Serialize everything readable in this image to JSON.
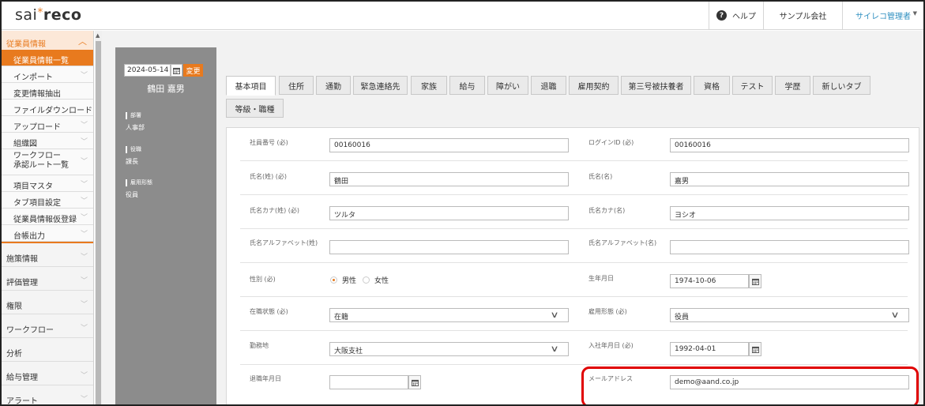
{
  "header": {
    "logo_part1": "sai",
    "logo_star": "*",
    "logo_part2": "reco",
    "help_label": "ヘルプ",
    "company": "サンプル会社",
    "admin_user": "サイレコ管理者"
  },
  "sidebar": {
    "section_title": "従業員情報",
    "items": [
      {
        "label": "従業員情報一覧"
      },
      {
        "label": "インポート"
      },
      {
        "label": "変更情報抽出"
      },
      {
        "label": "ファイルダウンロード"
      },
      {
        "label": "アップロード"
      },
      {
        "label": "組織図"
      },
      {
        "label": "ワークフロー",
        "label2": "承認ルート一覧"
      },
      {
        "label": "項目マスタ"
      },
      {
        "label": "タブ項目設定"
      },
      {
        "label": "従業員情報仮登録"
      },
      {
        "label": "台帳出力"
      }
    ],
    "main_items": [
      {
        "label": "施策情報"
      },
      {
        "label": "評価管理"
      },
      {
        "label": "権限"
      },
      {
        "label": "ワークフロー"
      },
      {
        "label": "分析"
      },
      {
        "label": "給与管理"
      },
      {
        "label": "アラート"
      }
    ]
  },
  "profile": {
    "date": "2024-05-14",
    "change_button": "変更",
    "name": "鶴田 嘉男",
    "department_label": "部署",
    "department": "人事部",
    "position_label": "役職",
    "position": "課長",
    "employment_label": "雇用形態",
    "employment": "役員"
  },
  "tabs": [
    "基本項目",
    "住所",
    "通勤",
    "緊急連絡先",
    "家族",
    "給与",
    "障がい",
    "退職",
    "雇用契約",
    "第三号被扶養者",
    "資格",
    "テスト",
    "学歴",
    "新しいタブ",
    "等級・職種"
  ],
  "form": {
    "employee_no_label": "社員番号 (必)",
    "employee_no": "00160016",
    "login_id_label": "ログインID (必)",
    "login_id": "00160016",
    "last_name_label": "氏名(姓) (必)",
    "last_name": "鶴田",
    "first_name_label": "氏名(名)",
    "first_name": "嘉男",
    "last_kana_label": "氏名カナ(姓) (必)",
    "last_kana": "ツルタ",
    "first_kana_label": "氏名カナ(名)",
    "first_kana": "ヨシオ",
    "last_alpha_label": "氏名アルファベット(姓)",
    "last_alpha": "",
    "first_alpha_label": "氏名アルファベット(名)",
    "first_alpha": "",
    "gender_label": "性別 (必)",
    "gender_male": "男性",
    "gender_female": "女性",
    "birthday_label": "生年月日",
    "birthday": "1974-10-06",
    "status_label": "在職状態 (必)",
    "status": "在籍",
    "emp_type_label": "雇用形態 (必)",
    "emp_type": "役員",
    "workplace_label": "勤務地",
    "workplace": "大阪支社",
    "join_date_label": "入社年月日 (必)",
    "join_date": "1992-04-01",
    "retire_date_label": "退職年月日",
    "retire_date": "",
    "email_label": "メールアドレス",
    "email": "demo@aand.co.jp"
  },
  "colors": {
    "accent": "#e87a1e",
    "admin_link": "#2f8fc0",
    "highlight": "#e00000",
    "profile_bg": "#8c8c8c"
  }
}
